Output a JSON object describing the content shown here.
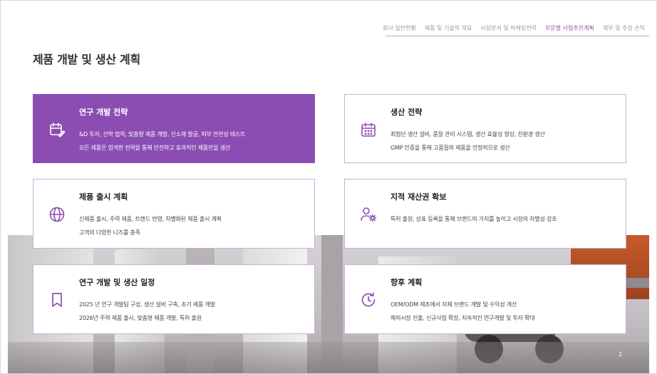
{
  "nav": {
    "items": [
      {
        "label": "회사 일반현황",
        "active": false
      },
      {
        "label": "제품 및 기술의 개요",
        "active": false
      },
      {
        "label": "시장분석 및 마케팅전략",
        "active": false
      },
      {
        "label": "부문별 사업추진계획",
        "active": true
      },
      {
        "label": "재무 및 추정 손익",
        "active": false
      }
    ]
  },
  "page_title": "제품 개발 및 생산 계획",
  "accent_color": "#8c4db3",
  "cards": [
    {
      "title": "연구 개발 전략",
      "icon": "calendar-edit-icon",
      "lines": [
        "&D 투자, 산학 협력, 맞춤형 제품 개발, 신소재 발굴, 피부 안전성 테스트",
        "모든 제품은 엄격한 전략을 통해 안전하고 효과적인 제품만을 생산"
      ]
    },
    {
      "title": "생산 전략",
      "icon": "calendar-grid-icon",
      "lines": [
        "최첨단 생산 설비, 품질 관리 시스템, 생산 효율성 향상, 친환경 생산",
        "GMP 인증을 통해 고품질의 제품을 안정적으로 생산"
      ]
    },
    {
      "title": "제품 출시 계획",
      "icon": "globe-icon",
      "lines": [
        "신제품 출시, 주력 제품, 트렌드 반영, 차별화된 제품 출시 계획",
        " 고객의 다양한 니즈를 충족"
      ]
    },
    {
      "title": "지적 재산권 확보",
      "icon": "user-gear-icon",
      "lines": [
        "특허 출원, 상표 등록을 통해 브랜드의 가치를 높이고 시장의 차별성 강조"
      ]
    },
    {
      "title": "연구 개발 및 생산 일정",
      "icon": "bookmark-icon",
      "lines": [
        "2025 년 연구 개발팀 구성, 생산 설비 구축, 초기 제품 개발",
        "2026년 주력 제품 출시, 맞춤형 제품 개발, 특허 출원"
      ]
    },
    {
      "title": "향후 계획",
      "icon": "clock-refresh-icon",
      "lines": [
        "OEM/ODM 제조에서 자체 브랜드 개발 및 수익성 개선",
        "해외시장 진출, 신규사업 확장, 지속적인 연구개발 및 투자 확대"
      ]
    }
  ],
  "page_number": "2"
}
